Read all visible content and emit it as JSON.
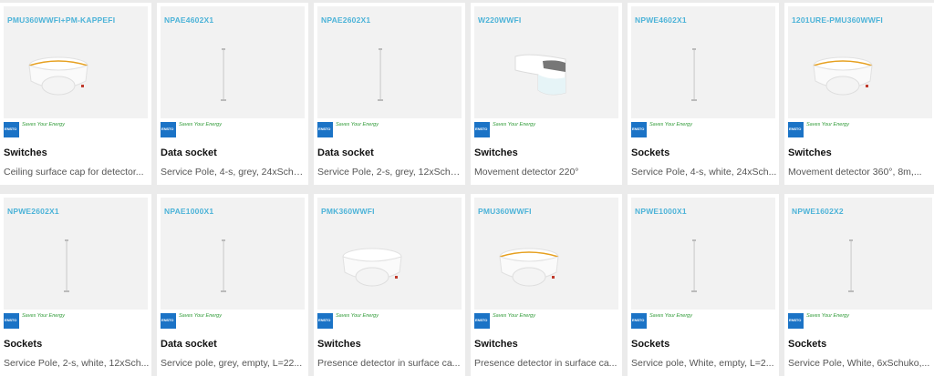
{
  "brand": {
    "logo_text": "ENSTO",
    "slogan": "Saves Your Energy"
  },
  "products": [
    {
      "code": "PMU360WWFI+PM-KAPPEFI",
      "category": "Switches",
      "description": "Ceiling surface cap for detector...",
      "image": "ceiling-detector-orange-ring"
    },
    {
      "code": "NPAE4602X1",
      "category": "Data socket",
      "description": "Service Pole, 4-s, grey, 24xSchu...",
      "image": "service-pole"
    },
    {
      "code": "NPAE2602X1",
      "category": "Data socket",
      "description": "Service Pole, 2-s, grey, 12xSchu...",
      "image": "service-pole"
    },
    {
      "code": "W220WWFI",
      "category": "Switches",
      "description": "Movement detector 220°",
      "image": "wall-detector"
    },
    {
      "code": "NPWE4602X1",
      "category": "Sockets",
      "description": "Service Pole, 4-s, white, 24xSch...",
      "image": "service-pole"
    },
    {
      "code": "1201URE-PMU360WWFI",
      "category": "Switches",
      "description": "Movement detector 360°, 8m,...",
      "image": "ceiling-detector-orange-ring"
    },
    {
      "code": "NPWE2602X1",
      "category": "Sockets",
      "description": "Service Pole, 2-s, white, 12xSch...",
      "image": "service-pole"
    },
    {
      "code": "NPAE1000X1",
      "category": "Data socket",
      "description": "Service pole, grey, empty, L=22...",
      "image": "service-pole"
    },
    {
      "code": "PMK360WWFI",
      "category": "Switches",
      "description": "Presence detector in surface ca...",
      "image": "ceiling-detector-white"
    },
    {
      "code": "PMU360WWFI",
      "category": "Switches",
      "description": "Presence detector in surface ca...",
      "image": "ceiling-detector-orange-ring"
    },
    {
      "code": "NPWE1000X1",
      "category": "Sockets",
      "description": "Service pole, White, empty, L=2...",
      "image": "service-pole"
    },
    {
      "code": "NPWE1602X2",
      "category": "Sockets",
      "description": "Service Pole, White, 6xSchuko,...",
      "image": "service-pole"
    }
  ],
  "colors": {
    "code": "#4cb3d8",
    "brand_blue": "#1b73c6",
    "slogan_green": "#2e9a36",
    "accent_ring": "#e6a020"
  }
}
